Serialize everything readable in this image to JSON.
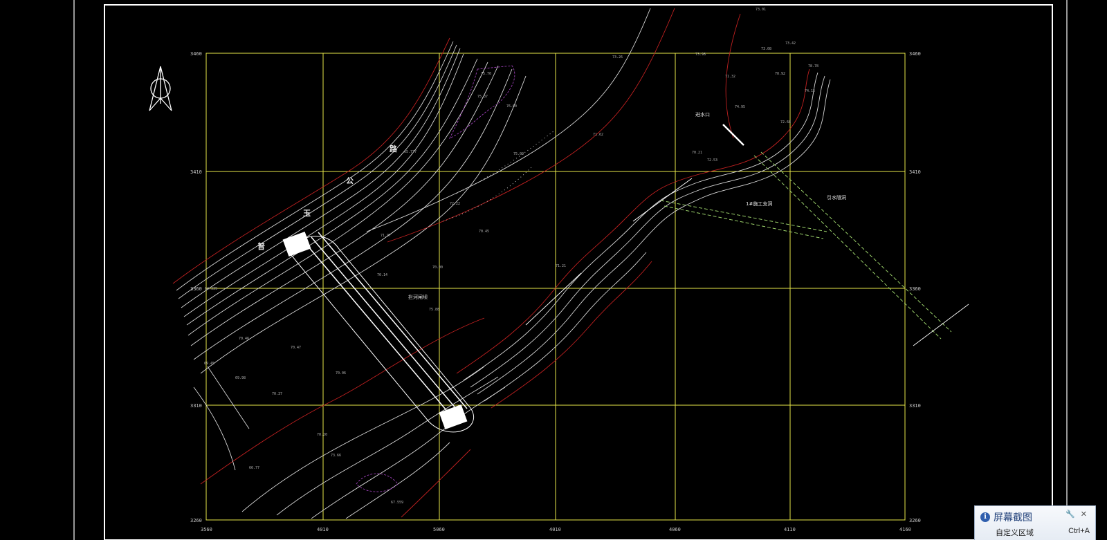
{
  "drawing": {
    "labels": {
      "intake": "进水口",
      "diversion_tunnel": "引水隧洞",
      "branch_tunnel": "1#施工支洞",
      "dam_axis": "拦河闸坝",
      "road_char_1": "公",
      "road_char_2": "路",
      "village_1": "玉",
      "village_2": "普"
    },
    "x_ticks": [
      "3560",
      "4010",
      "5060",
      "4010",
      "4060",
      "4110",
      "4160"
    ],
    "y_ticks_left": [
      "3460",
      "3410",
      "3360",
      "3310",
      "3260"
    ],
    "y_ticks_right": [
      "3460",
      "3410",
      "3360",
      "3310",
      "3260"
    ],
    "elevations": [
      "75.70",
      "75.37",
      "76.00",
      "75.00",
      "71.62",
      "72.22",
      "71.97",
      "70.45",
      "70.14",
      "70.00",
      "75.88",
      "70.46",
      "70.47",
      "69.45",
      "70.37",
      "69.98",
      "70.06",
      "65.777",
      "64.339",
      "66.77",
      "67.559",
      "70.20",
      "73.66",
      "70.21",
      "72.53",
      "71.32",
      "70.92",
      "73.08",
      "73.42",
      "73.01",
      "78.78",
      "74.15",
      "74.95",
      "73.98",
      "73.26",
      "72.68",
      "71.21"
    ]
  },
  "snip_popup": {
    "title": "屏幕截图",
    "command": "自定义区域",
    "shortcut": "Ctrl+A"
  },
  "colors": {
    "grid": "#e8e84a",
    "border": "#ffffff",
    "terrain_red": "#c02020",
    "contour": "#d8d8d8",
    "tunnel_green": "#9ad06a",
    "purple": "#9b3fb5"
  }
}
